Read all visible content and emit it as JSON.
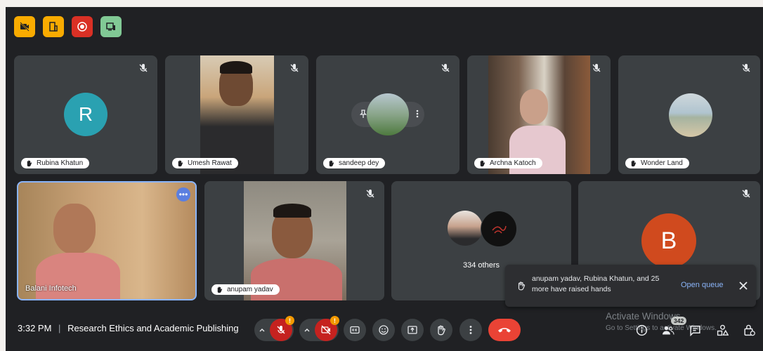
{
  "participants": [
    {
      "name": "Rubina Khatun",
      "avatar_letter": "R",
      "avatar_color": "#2aa1b1"
    },
    {
      "name": "Umesh Rawat"
    },
    {
      "name": "sandeep dey"
    },
    {
      "name": "Archna Katoch"
    },
    {
      "name": "Wonder Land"
    },
    {
      "name": "Balani Infotech"
    },
    {
      "name": "anupam yadav"
    },
    {
      "others_label": "334 others"
    },
    {
      "avatar_letter": "B",
      "avatar_color": "#d04a1e"
    }
  ],
  "meeting": {
    "time": "3:32 PM",
    "separator": "|",
    "title": "Research Ethics and Academic Publishing"
  },
  "toast": {
    "message": "anupam yadav, Rubina Khatun, and 25 more have raised hands",
    "action": "Open queue"
  },
  "badges": {
    "mic_alert": "!",
    "cam_alert": "!",
    "people_count": "342"
  },
  "watermark": {
    "line1": "Activate Windows",
    "line2": "Go to Settings to activate Windows."
  },
  "colors": {
    "toolbar_yellow": "#f9ab00",
    "toolbar_red": "#d93025",
    "toolbar_green": "#81c995",
    "end_call": "#ea4335",
    "active_border": "#8ab4f8"
  }
}
